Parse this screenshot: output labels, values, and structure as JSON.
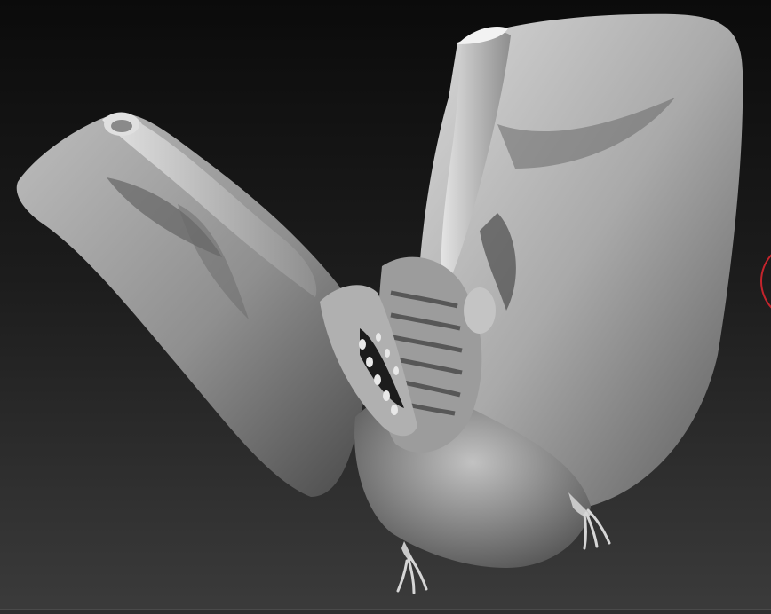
{
  "viewport": {
    "background_top": "#0b0b0b",
    "background_bottom": "#3b3b3b",
    "model_light": "#dcdcdc",
    "model_mid": "#8a8a8a",
    "model_shadow": "#1e1e1e",
    "brush_cursor_color": "#c4242c",
    "bottom_edge_color": "#2e2e2e"
  }
}
